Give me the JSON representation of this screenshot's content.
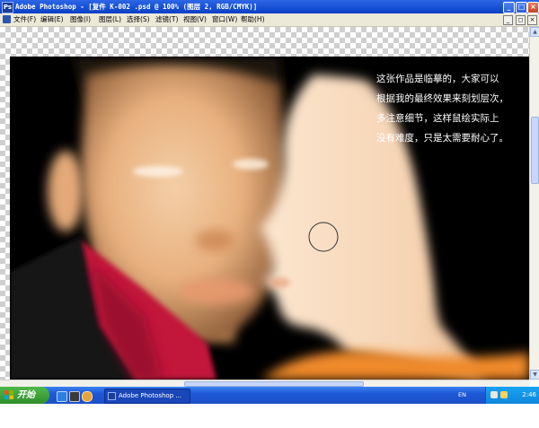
{
  "window": {
    "title": "Adobe Photoshop - [复件 K-002 .psd @ 100% (图层 2, RGB/CMYK)]",
    "app_icon": "Ps",
    "minimize_glyph": "_",
    "maximize_glyph": "□",
    "close_glyph": "×"
  },
  "menubar": {
    "items": [
      "文件(F)",
      "编辑(E)",
      "图像(I)",
      "图层(L)",
      "选择(S)",
      "滤镜(T)",
      "视图(V)",
      "窗口(W)",
      "帮助(H)"
    ],
    "doc_minimize_glyph": "_",
    "doc_restore_glyph": "◻",
    "doc_close_glyph": "×"
  },
  "canvas": {
    "annotation_lines": [
      "这张作品是临摹的，大家可以",
      "根据我的最终效果来刻划层次，",
      "多注意细节，这样鼠绘实际上",
      "没有难度，只是太需要耐心了。"
    ],
    "text_color": "#ffffff",
    "background_color": "#000000",
    "brush_cursor_icon": "circle-brush-cursor-icon"
  },
  "taskbar": {
    "start_label": "开始",
    "active_task": "Adobe Photoshop ...",
    "language": "EN",
    "clock": "2:46"
  },
  "colors": {
    "titlebar": "#0a3fc7",
    "taskbar": "#1e58d6",
    "start_button": "#2f8f2b",
    "scarf": "#c2173a",
    "skin": "#f6d3b2"
  }
}
